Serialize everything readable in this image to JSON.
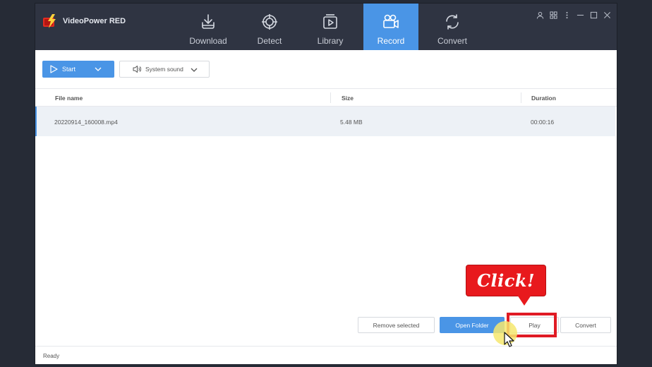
{
  "app": {
    "name": "VideoPower RED"
  },
  "nav": {
    "tabs": [
      {
        "label": "Download",
        "icon": "download-icon",
        "active": false
      },
      {
        "label": "Detect",
        "icon": "target-icon",
        "active": false
      },
      {
        "label": "Library",
        "icon": "library-icon",
        "active": false
      },
      {
        "label": "Record",
        "icon": "camera-icon",
        "active": true
      },
      {
        "label": "Convert",
        "icon": "convert-icon",
        "active": false
      }
    ]
  },
  "window_controls": [
    "user-icon",
    "grid-icon",
    "more-icon",
    "minimize-icon",
    "maximize-icon",
    "close-icon"
  ],
  "toolbar": {
    "start_label": "Start",
    "audio_source": "System sound"
  },
  "table": {
    "columns": [
      "File name",
      "Size",
      "Duration"
    ],
    "rows": [
      {
        "file_name": "20220914_160008.mp4",
        "size": "5.48 MB",
        "duration": "00:00:16"
      }
    ]
  },
  "actions": {
    "remove_selected": "Remove selected",
    "open_folder": "Open Folder",
    "play": "Play",
    "convert": "Convert"
  },
  "status": {
    "text": "Ready"
  },
  "annotation": {
    "callout": "Click!"
  },
  "colors": {
    "accent": "#4a95e6",
    "titlebar": "#2f3442",
    "annotation_red": "#e8191d"
  }
}
